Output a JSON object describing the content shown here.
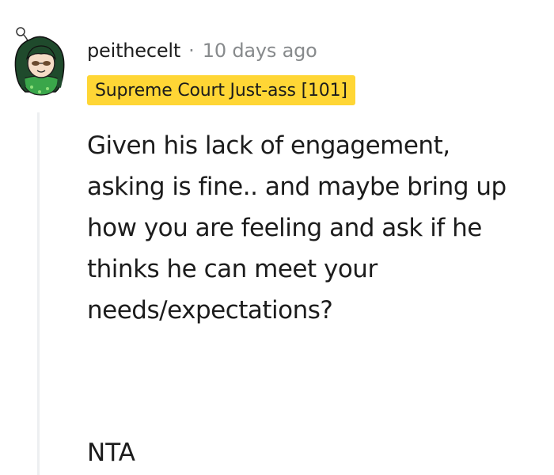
{
  "comment": {
    "author": "peithecelt",
    "separator": "·",
    "timestamp": "10 days ago",
    "flair": "Supreme Court Just-ass [101]",
    "flair_color": "#ffd635",
    "avatar_icon": "avatar-icon",
    "body_lines": [
      "Given his lack of engagement,",
      "asking is fine.. and maybe bring up",
      "how you are feeling and ask if he",
      "thinks he can meet your",
      "needs/expectations?"
    ],
    "verdict": "NTA"
  }
}
